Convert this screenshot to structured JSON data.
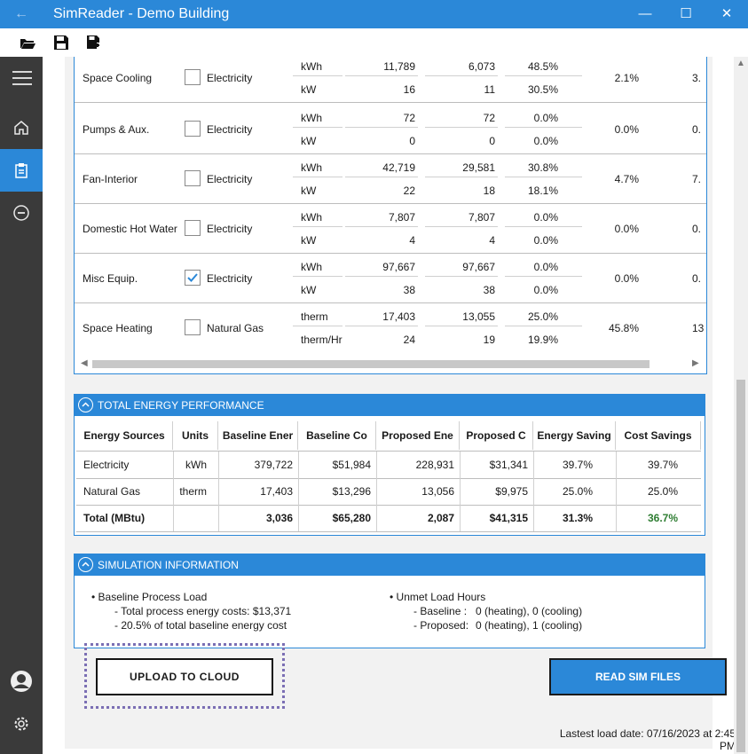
{
  "window": {
    "title": "SimReader - Demo Building",
    "back_glyph": "←",
    "minimize_glyph": "—",
    "maximize_glyph": "☐",
    "close_glyph": "✕"
  },
  "toolbar": {
    "icons": [
      "open-folder-icon",
      "save-icon",
      "save-as-icon"
    ]
  },
  "nav": {
    "items": [
      "menu-icon",
      "home-icon",
      "clipboard-icon",
      "more-icon"
    ],
    "active": "clipboard-icon",
    "bottom_items": [
      "user-icon",
      "gear-icon"
    ]
  },
  "end_uses": [
    {
      "name": "Space Cooling",
      "checked": false,
      "fuel": "Electricity",
      "unit1": "kWh",
      "b1": "11,789",
      "p1": "6,073",
      "s1": "48.5%",
      "unit2": "kW",
      "b2": "16",
      "p2": "11",
      "s2": "30.5%",
      "pct": "2.1%",
      "cut": "3."
    },
    {
      "name": "Pumps & Aux.",
      "checked": false,
      "fuel": "Electricity",
      "unit1": "kWh",
      "b1": "72",
      "p1": "72",
      "s1": "0.0%",
      "unit2": "kW",
      "b2": "0",
      "p2": "0",
      "s2": "0.0%",
      "pct": "0.0%",
      "cut": "0."
    },
    {
      "name": "Fan-Interior",
      "checked": false,
      "fuel": "Electricity",
      "unit1": "kWh",
      "b1": "42,719",
      "p1": "29,581",
      "s1": "30.8%",
      "unit2": "kW",
      "b2": "22",
      "p2": "18",
      "s2": "18.1%",
      "pct": "4.7%",
      "cut": "7."
    },
    {
      "name": "Domestic Hot Water",
      "checked": false,
      "fuel": "Electricity",
      "unit1": "kWh",
      "b1": "7,807",
      "p1": "7,807",
      "s1": "0.0%",
      "unit2": "kW",
      "b2": "4",
      "p2": "4",
      "s2": "0.0%",
      "pct": "0.0%",
      "cut": "0."
    },
    {
      "name": "Misc Equip.",
      "checked": true,
      "fuel": "Electricity",
      "unit1": "kWh",
      "b1": "97,667",
      "p1": "97,667",
      "s1": "0.0%",
      "unit2": "kW",
      "b2": "38",
      "p2": "38",
      "s2": "0.0%",
      "pct": "0.0%",
      "cut": "0."
    },
    {
      "name": "Space Heating",
      "checked": false,
      "fuel": "Natural Gas",
      "unit1": "therm",
      "b1": "17,403",
      "p1": "13,055",
      "s1": "25.0%",
      "unit2": "therm/Hr",
      "b2": "24",
      "p2": "19",
      "s2": "19.9%",
      "pct": "45.8%",
      "cut": "13"
    }
  ],
  "total_panel": {
    "title": "TOTAL ENERGY PERFORMANCE",
    "headers": [
      "Energy Sources",
      "Units",
      "Baseline Ener",
      "Baseline Co",
      "Proposed Ene",
      "Proposed C",
      "Energy Saving",
      "Cost Savings"
    ],
    "rows": [
      [
        "Electricity",
        "kWh",
        "379,722",
        "$51,984",
        "228,931",
        "$31,341",
        "39.7%",
        "39.7%"
      ],
      [
        "Natural Gas",
        "therm",
        "17,403",
        "$13,296",
        "13,056",
        "$9,975",
        "25.0%",
        "25.0%"
      ],
      [
        "Total (MBtu)",
        "",
        "3,036",
        "$65,280",
        "2,087",
        "$41,315",
        "31.3%",
        "36.7%"
      ]
    ],
    "highlight_color": "#2e7d32"
  },
  "sim_panel": {
    "title": "SIMULATION INFORMATION",
    "left": {
      "heading": "• Baseline Process Load",
      "line1": "-  Total process energy costs: $13,371",
      "line2": "-  20.5% of total baseline energy cost"
    },
    "right": {
      "heading": "• Unmet Load Hours",
      "line1_label": "- Baseline  :",
      "line1_value": "0 (heating), 0 (cooling)",
      "line2_label": "- Proposed:",
      "line2_value": "0 (heating), 1 (cooling)"
    }
  },
  "buttons": {
    "upload": "UPLOAD TO CLOUD",
    "read": "READ SIM FILES"
  },
  "last_load": "Lastest load date: 07/16/2023 at 2:45 PM",
  "colors": {
    "accent": "#2b88d8",
    "rail": "#3a3a3a",
    "focus": "#7b6fb4"
  }
}
